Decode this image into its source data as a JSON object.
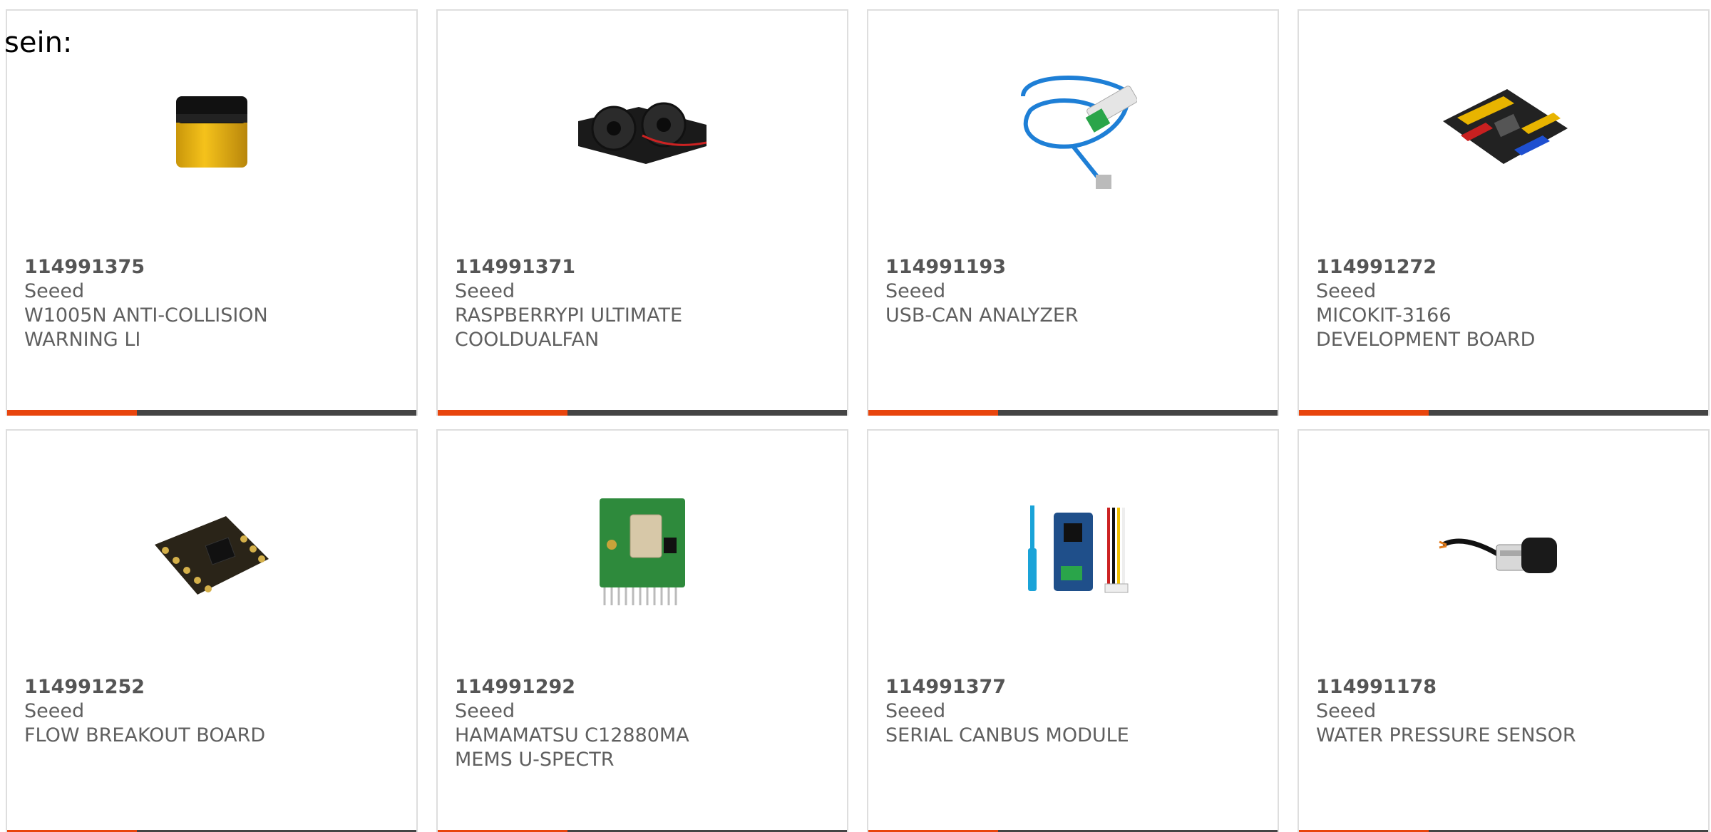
{
  "intro_text": "sein:",
  "colors": {
    "accent": "#e8450d",
    "bar": "#444444",
    "border": "#dedede",
    "text": "#5f5f5f"
  },
  "products": [
    {
      "sku": "114991375",
      "brand": "Seeed",
      "name": "W1005N ANTI-COLLISION WARNING LI",
      "image": "yellow-cylinder-sensor"
    },
    {
      "sku": "114991371",
      "brand": "Seeed",
      "name": "RASPBERRYPI ULTIMATE COOLDUALFAN",
      "image": "dual-fan"
    },
    {
      "sku": "114991193",
      "brand": "Seeed",
      "name": "USB-CAN ANALYZER",
      "image": "usb-can-cable"
    },
    {
      "sku": "114991272",
      "brand": "Seeed",
      "name": "MICOKIT-3166 DEVELOPMENT BOARD",
      "image": "dev-board"
    },
    {
      "sku": "114991252",
      "brand": "Seeed",
      "name": "FLOW BREAKOUT BOARD",
      "image": "breakout-board"
    },
    {
      "sku": "114991292",
      "brand": "Seeed",
      "name": "HAMAMATSU C12880MA MEMS U-SPECTR",
      "image": "spectrometer-board"
    },
    {
      "sku": "114991377",
      "brand": "Seeed",
      "name": "SERIAL CANBUS MODULE",
      "image": "grove-can-module"
    },
    {
      "sku": "114991178",
      "brand": "Seeed",
      "name": "WATER PRESSURE SENSOR",
      "image": "pressure-sensor"
    }
  ]
}
